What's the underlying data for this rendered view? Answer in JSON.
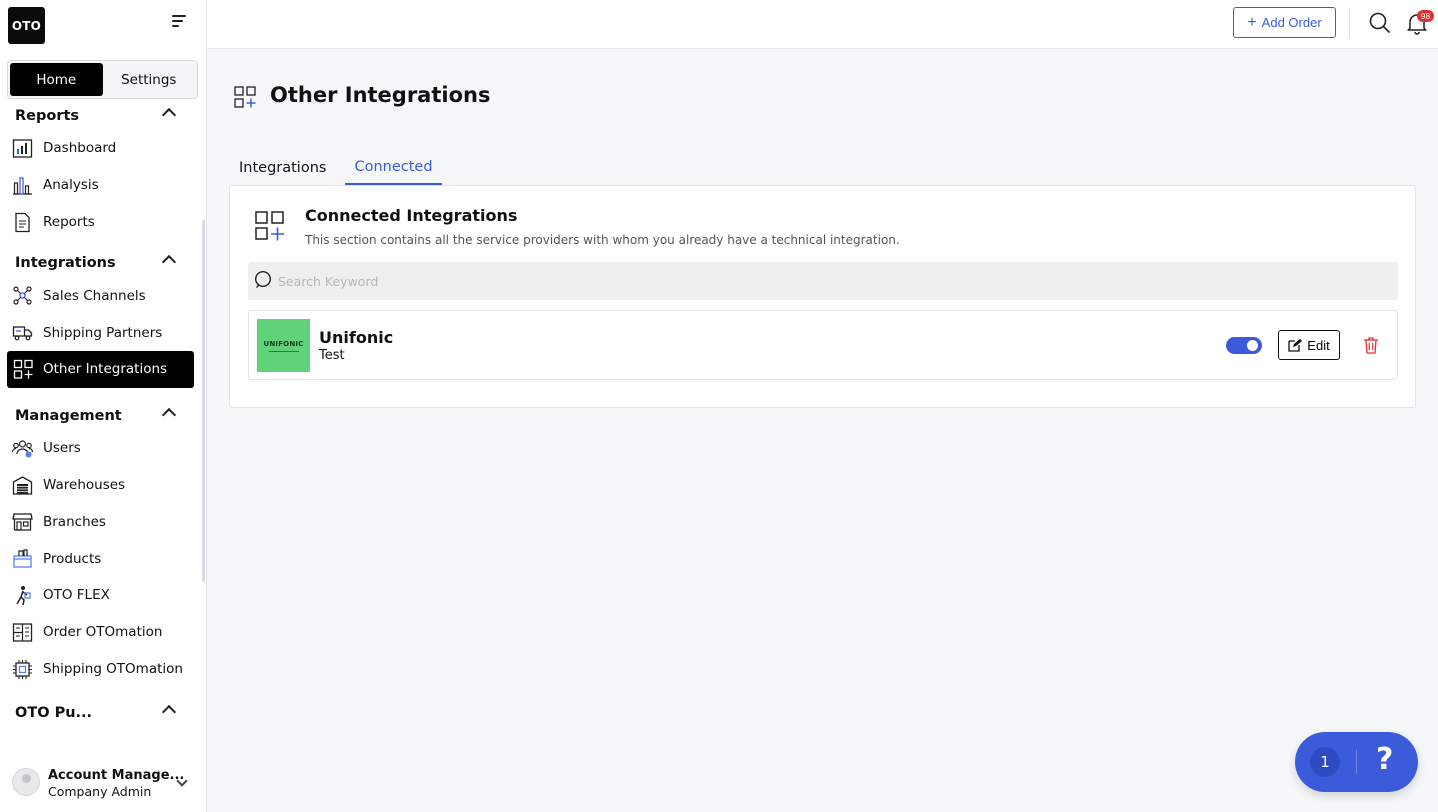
{
  "brand": {
    "logo_text": "OTO"
  },
  "sidebar": {
    "segments": {
      "home": "Home",
      "settings": "Settings"
    },
    "sections": [
      {
        "title": "Reports",
        "items": [
          "Dashboard",
          "Analysis",
          "Reports"
        ]
      },
      {
        "title": "Integrations",
        "items": [
          "Sales Channels",
          "Shipping Partners",
          "Other Integrations"
        ]
      },
      {
        "title": "Management",
        "items": [
          "Users",
          "Warehouses",
          "Branches",
          "Products",
          "OTO FLEX",
          "Order OTOmation",
          "Shipping OTOmation"
        ]
      },
      {
        "title": "OTO Pu..."
      }
    ],
    "active_item": "Other Integrations",
    "user": {
      "name": "Account Manage...",
      "role": "Company Admin"
    }
  },
  "topbar": {
    "add_order_label": "Add Order",
    "notifications_count": "98"
  },
  "main": {
    "page_title": "Other Integrations",
    "tabs": [
      {
        "label": "Integrations",
        "active": false
      },
      {
        "label": "Connected",
        "active": true
      }
    ],
    "card": {
      "title": "Connected Integrations",
      "description": "This section contains all the service providers with whom you already have a technical integration.",
      "search_placeholder": "Search Keyword",
      "rows": [
        {
          "name": "Unifonic",
          "subtitle": "Test",
          "logo_text": "UNIFONIC",
          "logo_color": "#5fd27a",
          "enabled": true,
          "edit_label": "Edit"
        }
      ]
    }
  },
  "help_widget": {
    "count": "1",
    "symbol": "?"
  },
  "colors": {
    "accent": "#3b5bdb",
    "danger": "#e03131",
    "active_nav": "#000000"
  }
}
